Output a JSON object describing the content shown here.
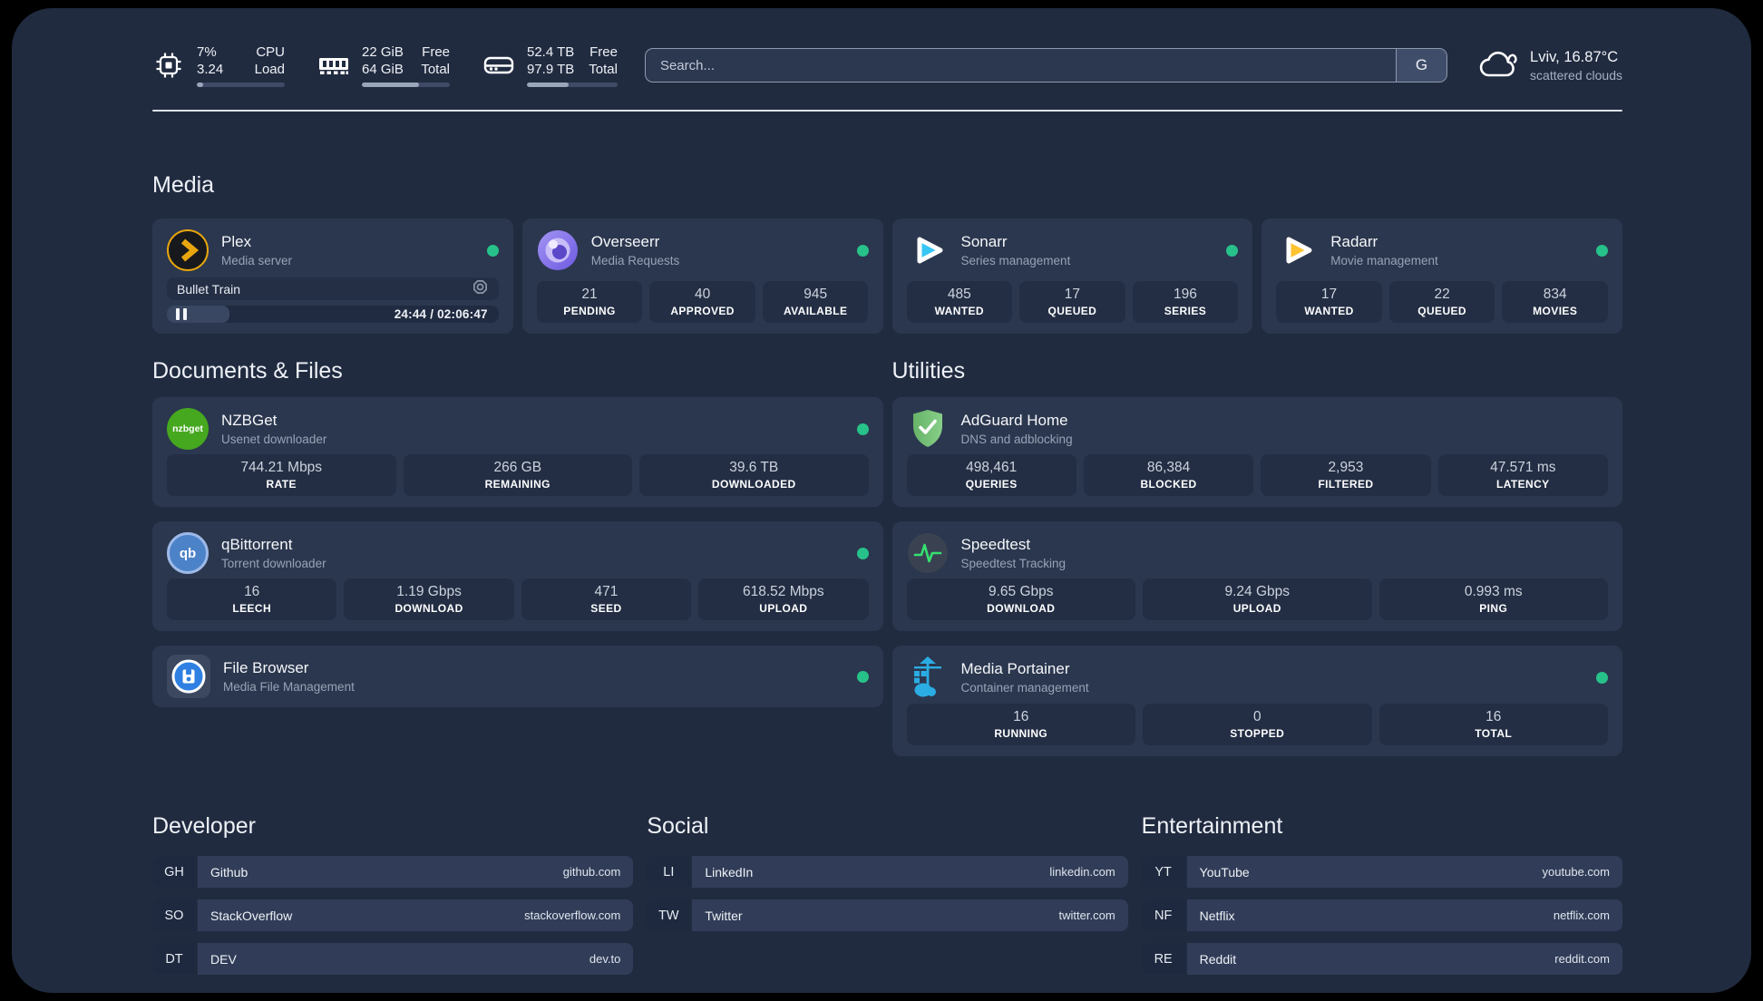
{
  "colors": {
    "page_bg": "#212b40",
    "card_bg": "#2b374e",
    "stat_bg": "#232e44",
    "status_ok": "#27c28a",
    "plex_amber": "#e8a50e",
    "overseerr_purple": "#8d7bf0",
    "sonarr_blue": "#38c6f4",
    "radarr_yellow": "#ffc230",
    "nzbget_green": "#46a81f",
    "adguard_green": "#62b462",
    "qbittorrent_blue": "#4c82c8",
    "speedtest_green": "#35e06f",
    "filebrowser_blue": "#2f80e2",
    "portainer_blue": "#2bace3"
  },
  "header": {
    "cpu": {
      "values": [
        "7%",
        "3.24"
      ],
      "labels": [
        "CPU",
        "Load"
      ],
      "progress": "7%"
    },
    "memory": {
      "values": [
        "22 GiB",
        "64 GiB"
      ],
      "labels": [
        "Free",
        "Total"
      ],
      "progress": "65%"
    },
    "disk": {
      "values": [
        "52.4 TB",
        "97.9 TB"
      ],
      "labels": [
        "Free",
        "Total"
      ],
      "progress": "46%"
    },
    "search": {
      "placeholder": "Search...",
      "button_label": "G"
    },
    "weather": {
      "location": "Lviv, 16.87°C",
      "condition": "scattered clouds"
    }
  },
  "sections": {
    "media": {
      "title": "Media",
      "plex": {
        "name": "Plex",
        "desc": "Media server",
        "now_playing": "Bullet Train",
        "time": "24:44 / 02:06:47",
        "progress": "19%"
      },
      "overseerr": {
        "name": "Overseerr",
        "desc": "Media Requests",
        "stats": [
          {
            "value": "21",
            "label": "PENDING"
          },
          {
            "value": "40",
            "label": "APPROVED"
          },
          {
            "value": "945",
            "label": "AVAILABLE"
          }
        ]
      },
      "sonarr": {
        "name": "Sonarr",
        "desc": "Series management",
        "stats": [
          {
            "value": "485",
            "label": "WANTED"
          },
          {
            "value": "17",
            "label": "QUEUED"
          },
          {
            "value": "196",
            "label": "SERIES"
          }
        ]
      },
      "radarr": {
        "name": "Radarr",
        "desc": "Movie management",
        "stats": [
          {
            "value": "17",
            "label": "WANTED"
          },
          {
            "value": "22",
            "label": "QUEUED"
          },
          {
            "value": "834",
            "label": "MOVIES"
          }
        ]
      }
    },
    "documents": {
      "title": "Documents & Files",
      "nzbget": {
        "name": "NZBGet",
        "desc": "Usenet downloader",
        "logo_text": "nzbget",
        "stats": [
          {
            "value": "744.21 Mbps",
            "label": "RATE"
          },
          {
            "value": "266 GB",
            "label": "REMAINING"
          },
          {
            "value": "39.6 TB",
            "label": "DOWNLOADED"
          }
        ]
      },
      "qbittorrent": {
        "name": "qBittorrent",
        "desc": "Torrent downloader",
        "logo_text": "qb",
        "stats": [
          {
            "value": "16",
            "label": "LEECH"
          },
          {
            "value": "1.19 Gbps",
            "label": "DOWNLOAD"
          },
          {
            "value": "471",
            "label": "SEED"
          },
          {
            "value": "618.52 Mbps",
            "label": "UPLOAD"
          }
        ]
      },
      "filebrowser": {
        "name": "File Browser",
        "desc": "Media File Management"
      }
    },
    "utilities": {
      "title": "Utilities",
      "adguard": {
        "name": "AdGuard Home",
        "desc": "DNS and adblocking",
        "stats": [
          {
            "value": "498,461",
            "label": "QUERIES"
          },
          {
            "value": "86,384",
            "label": "BLOCKED"
          },
          {
            "value": "2,953",
            "label": "FILTERED"
          },
          {
            "value": "47.571 ms",
            "label": "LATENCY"
          }
        ]
      },
      "speedtest": {
        "name": "Speedtest",
        "desc": "Speedtest Tracking",
        "stats": [
          {
            "value": "9.65 Gbps",
            "label": "DOWNLOAD"
          },
          {
            "value": "9.24 Gbps",
            "label": "UPLOAD"
          },
          {
            "value": "0.993 ms",
            "label": "PING"
          }
        ]
      },
      "portainer": {
        "name": "Media Portainer",
        "desc": "Container management",
        "stats": [
          {
            "value": "16",
            "label": "RUNNING"
          },
          {
            "value": "0",
            "label": "STOPPED"
          },
          {
            "value": "16",
            "label": "TOTAL"
          }
        ]
      }
    },
    "links": {
      "developer": {
        "title": "Developer",
        "items": [
          {
            "tag": "GH",
            "name": "Github",
            "url": "github.com"
          },
          {
            "tag": "SO",
            "name": "StackOverflow",
            "url": "stackoverflow.com"
          },
          {
            "tag": "DT",
            "name": "DEV",
            "url": "dev.to"
          }
        ]
      },
      "social": {
        "title": "Social",
        "items": [
          {
            "tag": "LI",
            "name": "LinkedIn",
            "url": "linkedin.com"
          },
          {
            "tag": "TW",
            "name": "Twitter",
            "url": "twitter.com"
          }
        ]
      },
      "entertainment": {
        "title": "Entertainment",
        "items": [
          {
            "tag": "YT",
            "name": "YouTube",
            "url": "youtube.com"
          },
          {
            "tag": "NF",
            "name": "Netflix",
            "url": "netflix.com"
          },
          {
            "tag": "RE",
            "name": "Reddit",
            "url": "reddit.com"
          }
        ]
      }
    }
  }
}
